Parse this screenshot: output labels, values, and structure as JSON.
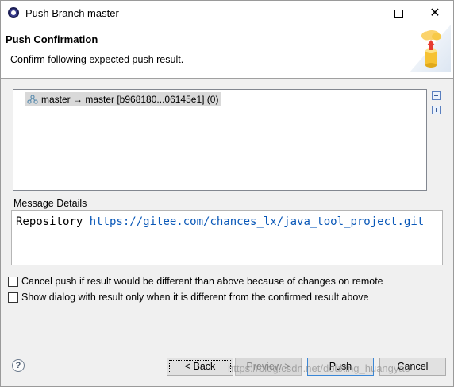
{
  "window": {
    "title": "Push Branch master"
  },
  "header": {
    "title": "Push Confirmation",
    "description": "Confirm following expected push result."
  },
  "tree": {
    "items": [
      {
        "label": "master → master [b968180...06145e1] (0)",
        "icon": "branch-icon"
      }
    ],
    "side_icons": [
      "collapse-all-icon",
      "expand-all-icon"
    ]
  },
  "message_details": {
    "label": "Message Details",
    "repository_prefix": "Repository",
    "repository_url": "https://gitee.com/chances_lx/java_tool_project.git"
  },
  "options": [
    {
      "label": "Cancel push if result would be different than above because of changes on remote",
      "checked": false
    },
    {
      "label": "Show dialog with result only when it is different from the confirmed result above",
      "checked": false
    }
  ],
  "footer": {
    "help_symbol": "?",
    "back_label": "< Back",
    "preview_label": "Preview >",
    "push_label": "Push",
    "cancel_label": "Cancel",
    "watermark": "https://blog.csdn.net/douxing_huangyao"
  },
  "colors": {
    "link": "#0a58b8",
    "push_button_border": "#3b87d6",
    "disabled_text": "#8a8a8a"
  }
}
